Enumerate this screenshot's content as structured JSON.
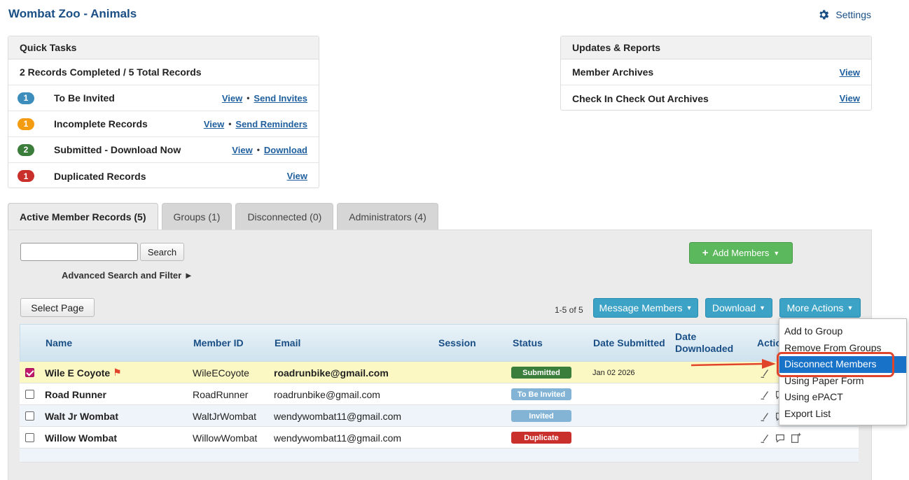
{
  "header": {
    "title": "Wombat Zoo - Animals",
    "settings_label": "Settings"
  },
  "quick_tasks": {
    "title": "Quick Tasks",
    "summary": "2 Records Completed / 5 Total Records",
    "rows": [
      {
        "count": "1",
        "color": "#3c8dbc",
        "label": "To Be Invited",
        "link1": "View",
        "link2": "Send Invites"
      },
      {
        "count": "1",
        "color": "#f39c12",
        "label": "Incomplete Records",
        "link1": "View",
        "link2": "Send Reminders"
      },
      {
        "count": "2",
        "color": "#3b7d3b",
        "label": "Submitted - Download Now",
        "link1": "View",
        "link2": "Download"
      },
      {
        "count": "1",
        "color": "#c9302c",
        "label": "Duplicated Records",
        "link1": "View",
        "link2": ""
      }
    ]
  },
  "updates": {
    "title": "Updates & Reports",
    "rows": [
      {
        "label": "Member Archives",
        "link": "View"
      },
      {
        "label": "Check In Check Out Archives",
        "link": "View"
      }
    ]
  },
  "tabs": [
    {
      "label": "Active Member Records (5)",
      "active": true
    },
    {
      "label": "Groups (1)",
      "active": false
    },
    {
      "label": "Disconnected (0)",
      "active": false
    },
    {
      "label": "Administrators (4)",
      "active": false
    }
  ],
  "toolbar": {
    "search_value": "",
    "search_button": "Search",
    "advanced_search": "Advanced Search and Filter ►",
    "add_members": "Add Members",
    "select_page": "Select Page",
    "pager": "1-5 of 5",
    "message_members": "Message Members",
    "download": "Download",
    "more_actions": "More Actions"
  },
  "table": {
    "headers": [
      "Name",
      "Member ID",
      "Email",
      "Session",
      "Status",
      "Date Submitted",
      "Date Downloaded",
      "Actio"
    ],
    "rows": [
      {
        "name": "Wile E Coyote",
        "flag": true,
        "member_id": "WileECoyote",
        "email": "roadrunbike@gmail.com",
        "session": "",
        "status": "Submitted",
        "date_submitted": "Jan 02 2026",
        "checked": true
      },
      {
        "name": "Road Runner",
        "flag": false,
        "member_id": "RoadRunner",
        "email": "roadrunbike@gmail.com",
        "session": "",
        "status": "To Be Invited",
        "date_submitted": "",
        "checked": false
      },
      {
        "name": "Walt Jr Wombat",
        "flag": false,
        "member_id": "WaltJrWombat",
        "email": "wendywombat11@gmail.com",
        "session": "",
        "status": "Invited",
        "date_submitted": "",
        "checked": false
      },
      {
        "name": "Willow Wombat",
        "flag": false,
        "member_id": "WillowWombat",
        "email": "wendywombat11@gmail.com",
        "session": "",
        "status": "Duplicate",
        "date_submitted": "",
        "checked": false
      }
    ]
  },
  "more_actions_menu": [
    {
      "label": "Add to Group",
      "highlighted": false
    },
    {
      "label": "Remove From Groups",
      "highlighted": false
    },
    {
      "label": "Disconnect Members",
      "highlighted": true
    },
    {
      "label": "Using Paper Form",
      "highlighted": false
    },
    {
      "label": "Using ePACT",
      "highlighted": false
    },
    {
      "label": "Export List",
      "highlighted": false
    }
  ],
  "colors": {
    "annotation": "#e0452b",
    "menu_highlight": "#1872c7"
  }
}
